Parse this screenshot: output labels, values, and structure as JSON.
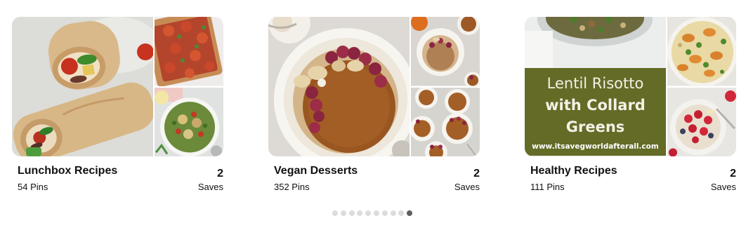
{
  "boards": [
    {
      "title": "Lunchbox Recipes",
      "pins": "54 Pins",
      "saves_count": "2",
      "saves_label": "Saves",
      "images": [
        "veggie-wrap-photo",
        "tomato-tart-photo",
        "quinoa-salad-photo"
      ]
    },
    {
      "title": "Vegan Desserts",
      "pins": "352 Pins",
      "saves_count": "2",
      "saves_label": "Saves",
      "images": [
        "pumpkin-pie-photo",
        "mini-pies-photo",
        "mini-tarts-photo"
      ]
    },
    {
      "title": "Healthy Recipes",
      "pins": "111 Pins",
      "saves_count": "2",
      "saves_label": "Saves",
      "images": [
        "lentil-risotto-photo",
        "roasted-squash-pasta-photo",
        "berry-oatmeal-photo"
      ],
      "overlay": {
        "line1": "Lentil Risotto",
        "line2": "with Collard",
        "line3": "Greens",
        "url": "www.itsavegworldafterall.com"
      }
    }
  ],
  "pagination": {
    "total": 10,
    "active_index": 9
  },
  "colors": {
    "text": "#111111",
    "dot_inactive": "#dcdcdc",
    "dot_active": "#5f5f5f",
    "overlay_bg": "#646b26"
  }
}
